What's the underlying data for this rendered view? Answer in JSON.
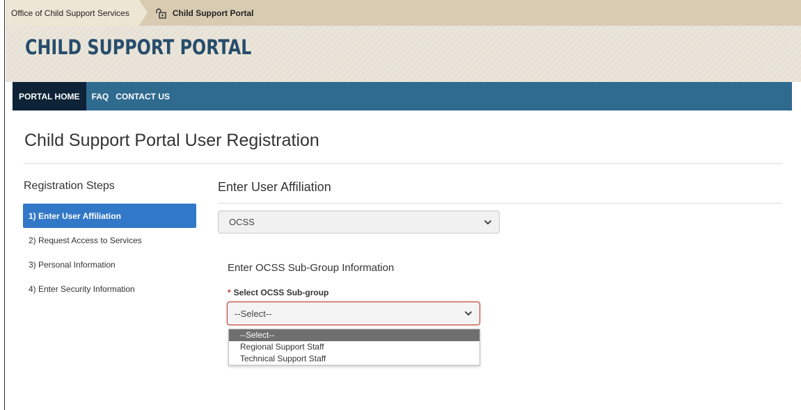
{
  "breadcrumb": {
    "home": "Office of Child Support Services",
    "current": "Child Support Portal"
  },
  "header": {
    "title": "CHILD SUPPORT PORTAL"
  },
  "nav": {
    "items": [
      {
        "label": "PORTAL HOME",
        "active": true
      },
      {
        "label": "FAQ",
        "active": false
      },
      {
        "label": "CONTACT US",
        "active": false
      }
    ]
  },
  "page": {
    "title": "Child Support Portal User Registration"
  },
  "steps": {
    "heading": "Registration Steps",
    "items": [
      {
        "label": "1) Enter User Affiliation",
        "active": true
      },
      {
        "label": "2) Request Access to Services",
        "active": false
      },
      {
        "label": "3) Personal Information",
        "active": false
      },
      {
        "label": "4) Enter Security Information",
        "active": false
      }
    ]
  },
  "affiliation": {
    "heading": "Enter User Affiliation",
    "selected": "OCSS"
  },
  "subgroup": {
    "heading": "Enter OCSS Sub-Group Information",
    "required_mark": "*",
    "label": "Select OCSS Sub-group",
    "selected": "--Select--",
    "options": [
      "--Select--",
      "Regional Support Staff",
      "Technical Support Staff"
    ],
    "highlighted_index": 0
  },
  "colors": {
    "nav_bar": "#2f6a8f",
    "nav_active": "#0e2337",
    "step_active": "#3278c8",
    "title_blue": "#274d6b",
    "breadcrumb_bg": "#d8cbb2",
    "error_red": "#c0392b"
  },
  "icons": {
    "breadcrumb_current": "portal-lock-icon",
    "select_chevron": "chevron-down-icon"
  }
}
